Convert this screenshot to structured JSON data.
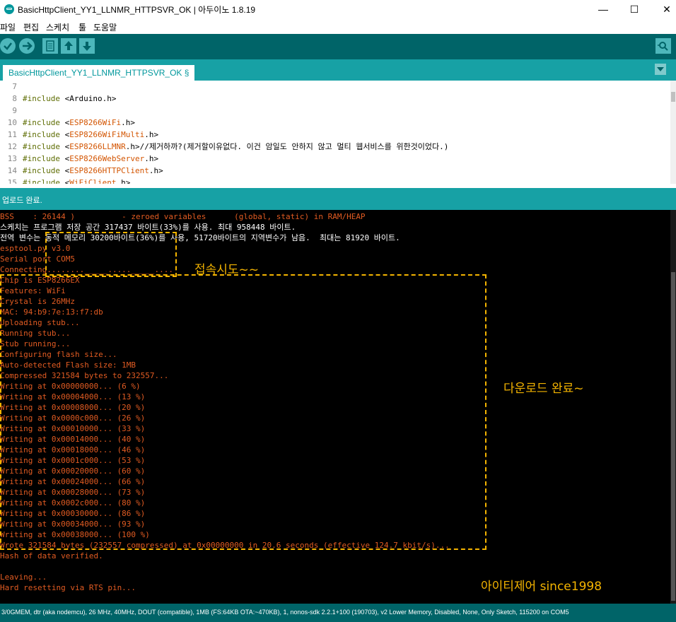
{
  "window": {
    "title": "BasicHttpClient_YY1_LLNMR_HTTPSVR_OK | 아두이노 1.8.19",
    "minimize": "—",
    "maximize": "☐",
    "close": "✕"
  },
  "menu": [
    "파일",
    "편집",
    "스케치",
    "툴",
    "도움말"
  ],
  "toolbar": {
    "buttons": [
      "verify-icon",
      "upload-icon",
      "new-icon",
      "open-icon",
      "save-icon",
      "serial-monitor-icon"
    ]
  },
  "tab": {
    "label": "BasicHttpClient_YY1_LLNMR_HTTPSVR_OK §"
  },
  "editor": {
    "lines": [
      {
        "n": "7",
        "pre": "",
        "lib": "",
        "rest": ""
      },
      {
        "n": "8",
        "pre": "#include",
        "lib": "",
        "rest": " <Arduino.h>"
      },
      {
        "n": "9",
        "pre": "",
        "lib": "",
        "rest": ""
      },
      {
        "n": "10",
        "pre": "#include",
        "lib": "ESP8266WiFi",
        "rest": ".h>",
        "open": " <"
      },
      {
        "n": "11",
        "pre": "#include",
        "lib": "ESP8266WiFiMulti",
        "rest": ".h>",
        "open": " <"
      },
      {
        "n": "12",
        "pre": "#include",
        "lib": "ESP8266LLMNR",
        "rest": ".h>//제거하까?(제거할이유없다. 이건 암일도 안하지 않고 멀티 웹서비스를 위한것이었다.)",
        "open": " <"
      },
      {
        "n": "13",
        "pre": "#include",
        "lib": "ESP8266WebServer",
        "rest": ".h>",
        "open": " <"
      },
      {
        "n": "14",
        "pre": "#include",
        "lib": "ESP8266HTTPClient",
        "rest": ".h>",
        "open": " <"
      },
      {
        "n": "15",
        "pre": "#include",
        "lib": "WiFiClient",
        "rest": ".h>",
        "open": " <"
      }
    ]
  },
  "status": {
    "message": "업로드 완료."
  },
  "console": {
    "lines": [
      {
        "t": "BSS    : 26144 )          - zeroed variables      (global, static) in RAM/HEAP",
        "c": "red"
      },
      {
        "t": "스케치는 프로그램 저장 공간 317437 바이트(33%)를 사용. 최대 958448 바이트.",
        "c": "white"
      },
      {
        "t": "전역 변수는 동적 메모리 30200바이트(36%)를 사용, 51720바이트의 지역변수가 남음.  최대는 81920 바이트.",
        "c": "white"
      },
      {
        "t": "esptool.py v3.0",
        "c": "red"
      },
      {
        "t": "Serial port COM5",
        "c": "red"
      },
      {
        "t": "Connecting........_____....._____....",
        "c": "red"
      },
      {
        "t": "Chip is ESP8266EX",
        "c": "red"
      },
      {
        "t": "Features: WiFi",
        "c": "red"
      },
      {
        "t": "Crystal is 26MHz",
        "c": "red"
      },
      {
        "t": "MAC: 94:b9:7e:13:f7:db",
        "c": "red"
      },
      {
        "t": "Uploading stub...",
        "c": "red"
      },
      {
        "t": "Running stub...",
        "c": "red"
      },
      {
        "t": "Stub running...",
        "c": "red"
      },
      {
        "t": "Configuring flash size...",
        "c": "red"
      },
      {
        "t": "Auto-detected Flash size: 1MB",
        "c": "red"
      },
      {
        "t": "Compressed 321584 bytes to 232557...",
        "c": "red"
      },
      {
        "t": "Writing at 0x00000000... (6 %)",
        "c": "red"
      },
      {
        "t": "Writing at 0x00004000... (13 %)",
        "c": "red"
      },
      {
        "t": "Writing at 0x00008000... (20 %)",
        "c": "red"
      },
      {
        "t": "Writing at 0x0000c000... (26 %)",
        "c": "red"
      },
      {
        "t": "Writing at 0x00010000... (33 %)",
        "c": "red"
      },
      {
        "t": "Writing at 0x00014000... (40 %)",
        "c": "red"
      },
      {
        "t": "Writing at 0x00018000... (46 %)",
        "c": "red"
      },
      {
        "t": "Writing at 0x0001c000... (53 %)",
        "c": "red"
      },
      {
        "t": "Writing at 0x00020000... (60 %)",
        "c": "red"
      },
      {
        "t": "Writing at 0x00024000... (66 %)",
        "c": "red"
      },
      {
        "t": "Writing at 0x00028000... (73 %)",
        "c": "red"
      },
      {
        "t": "Writing at 0x0002c000... (80 %)",
        "c": "red"
      },
      {
        "t": "Writing at 0x00030000... (86 %)",
        "c": "red"
      },
      {
        "t": "Writing at 0x00034000... (93 %)",
        "c": "red"
      },
      {
        "t": "Writing at 0x00038000... (100 %)",
        "c": "red"
      },
      {
        "t": "Wrote 321584 bytes (232557 compressed) at 0x00000000 in 20.6 seconds (effective 124.7 kbit/s)...",
        "c": "red"
      },
      {
        "t": "Hash of data verified.",
        "c": "red"
      },
      {
        "t": "",
        "c": "red"
      },
      {
        "t": "Leaving...",
        "c": "red"
      },
      {
        "t": "Hard resetting via RTS pin...",
        "c": "red"
      }
    ],
    "annotations": {
      "connect": "접속시도~~",
      "download": "다운로드 완료~",
      "brand": "아이티제어 since1998"
    },
    "annotation_color": "#f4b400"
  },
  "bottom": {
    "board_info": "3/0GMEM, dtr (aka nodemcu), 26 MHz, 40MHz, DOUT (compatible), 1MB (FS:64KB OTA:~470KB), 1, nonos-sdk 2.2.1+100 (190703), v2 Lower Memory, Disabled, None, Only Sketch, 115200 on COM5"
  },
  "colors": {
    "toolbar": "#006468",
    "tabstrip": "#17a1a5",
    "console_text": "#e15b22"
  }
}
